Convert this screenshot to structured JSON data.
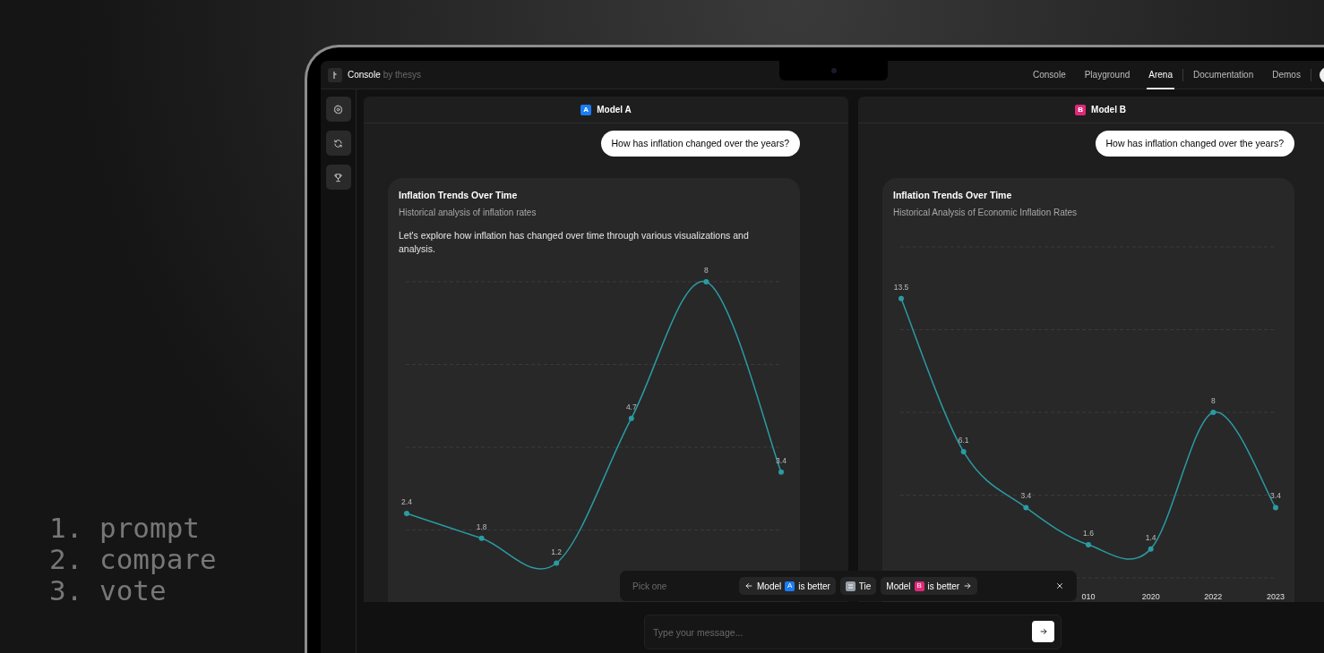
{
  "steps": [
    "1. prompt",
    "2. compare",
    "3. vote"
  ],
  "app": {
    "brand": "Console",
    "brand_suffix": "by thesys"
  },
  "nav": [
    {
      "label": "Console",
      "selected": false
    },
    {
      "label": "Playground",
      "selected": false
    },
    {
      "label": "Arena",
      "selected": true
    },
    {
      "label": "Documentation",
      "selected": false
    },
    {
      "label": "Demos",
      "selected": false
    }
  ],
  "sidebar": [
    {
      "kind": "settings"
    },
    {
      "kind": "refresh"
    },
    {
      "kind": "trophy"
    }
  ],
  "panels": [
    {
      "badge": "A",
      "color": "#1a7cf5",
      "name": "Model A",
      "prompt": "How has inflation changed over the years?",
      "card": {
        "title": "Inflation Trends Over Time",
        "subtitle": "Historical analysis of inflation rates",
        "text": "Let's explore how inflation has changed over time through various visualizations and analysis.",
        "chart_data": {
          "type": "line",
          "data_labels": true,
          "series": [
            {
              "color": "#2b9ba3",
              "marker": true,
              "values": [
                2.4,
                1.8,
                1.2,
                4.7,
                8,
                3.4
              ]
            }
          ]
        }
      }
    },
    {
      "badge": "B",
      "color": "#e0287a",
      "name": "Model B",
      "prompt": "How has inflation changed over the years?",
      "card": {
        "title": "Inflation Trends Over Time",
        "subtitle": "Historical Analysis of Economic Inflation Rates",
        "chart_data": {
          "type": "line",
          "data_labels": true,
          "categories": [
            null,
            null,
            null,
            "010",
            "2020",
            "2022",
            "2023"
          ],
          "series": [
            {
              "color": "#2b9ba3",
              "marker": true,
              "values": [
                13.5,
                6.1,
                3.4,
                1.6,
                1.4,
                8,
                3.4
              ]
            }
          ]
        }
      }
    }
  ],
  "vote": {
    "label": "Pick one",
    "options": [
      {
        "kind": "left",
        "prefix": "Model",
        "badge": "A",
        "color": "#1a7cf5",
        "suffix": "is better"
      },
      {
        "kind": "tie",
        "suffix": "Tie"
      },
      {
        "kind": "right",
        "prefix": "Model",
        "badge": "B",
        "color": "#e0287a",
        "suffix": "is better"
      }
    ]
  },
  "composer": {
    "placeholder": "Type your message..."
  }
}
